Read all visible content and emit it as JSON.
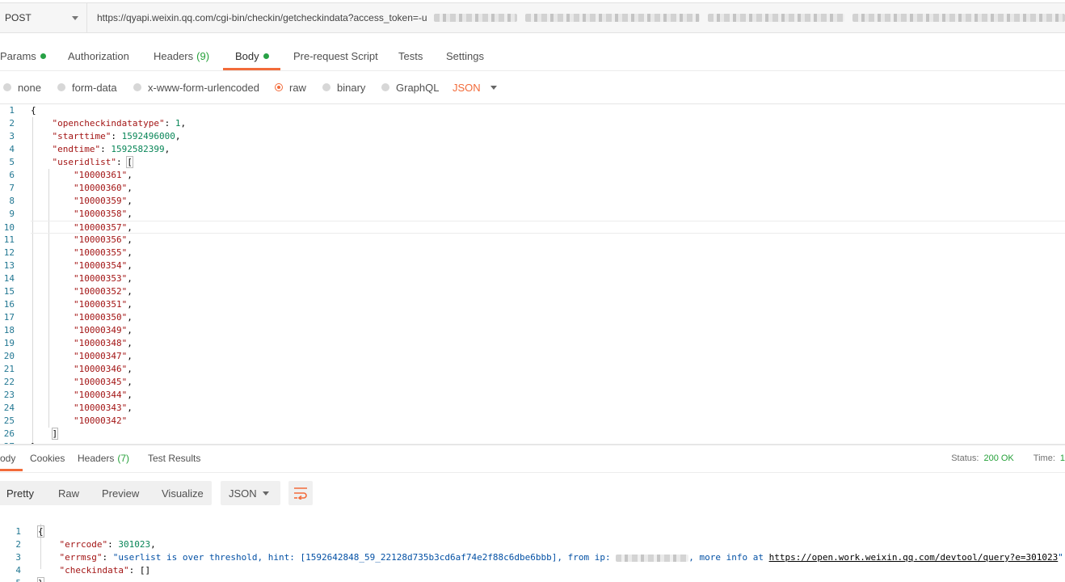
{
  "request": {
    "method": "POST",
    "url_prefix": "https://qyapi.weixin.qq.com/cgi-bin/checkin/getcheckindata?access_token=-u"
  },
  "req_tabs": [
    {
      "label": "Params",
      "dot": true
    },
    {
      "label": "Authorization"
    },
    {
      "label": "Headers",
      "count": "(9)"
    },
    {
      "label": "Body",
      "dot": true,
      "active": true
    },
    {
      "label": "Pre-request Script"
    },
    {
      "label": "Tests"
    },
    {
      "label": "Settings"
    }
  ],
  "body_types": [
    "none",
    "form-data",
    "x-www-form-urlencoded",
    "raw",
    "binary",
    "GraphQL"
  ],
  "body_type_selected": "raw",
  "body_format": "JSON",
  "request_body": {
    "keys": {
      "type": "\"opencheckindatatype\"",
      "start": "\"starttime\"",
      "end": "\"endtime\"",
      "list": "\"useridlist\""
    },
    "values": {
      "type": "1",
      "start": "1592496000",
      "end": "1592582399"
    },
    "userids": [
      "10000361",
      "10000360",
      "10000359",
      "10000358",
      "10000357",
      "10000356",
      "10000355",
      "10000354",
      "10000353",
      "10000352",
      "10000351",
      "10000350",
      "10000349",
      "10000348",
      "10000347",
      "10000346",
      "10000345",
      "10000344",
      "10000343",
      "10000342"
    ]
  },
  "res_tabs": [
    {
      "label": "ody",
      "active": true
    },
    {
      "label": "Cookies"
    },
    {
      "label": "Headers",
      "count": "(7)"
    },
    {
      "label": "Test Results"
    }
  ],
  "status": {
    "label": "Status:",
    "value": "200 OK",
    "time_label": "Time:",
    "time_value": "1"
  },
  "view_modes": [
    "Pretty",
    "Raw",
    "Preview",
    "Visualize"
  ],
  "view_selected": "Pretty",
  "response_format": "JSON",
  "response": {
    "errcode_key": "\"errcode\"",
    "errcode": "301023",
    "errmsg_key": "\"errmsg\"",
    "errmsg_text": "\"userlist is over threshold, hint: [1592642848_59_22128d735b3cd6af74e2f88c6dbe6bbb], from ip: ",
    "errmsg_more": ", more info at ",
    "errmsg_link": "https://open.work.weixin.qq.com/devtool/query?e=301023",
    "checkindata_key": "\"checkindata\"",
    "checkindata_val": "[]"
  },
  "colors": {
    "accent": "#f26b3a",
    "green": "#26a13a",
    "linenum": "#237893"
  }
}
